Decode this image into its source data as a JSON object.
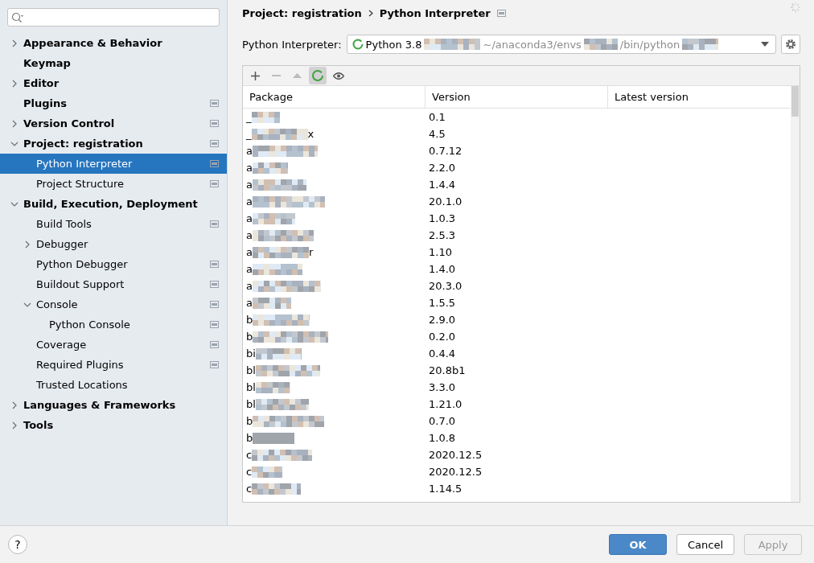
{
  "sidebar": {
    "items": [
      {
        "label": "Appearance & Behavior",
        "expanded": false,
        "selected": false,
        "project_scope": false
      },
      {
        "label": "Keymap",
        "selected": false,
        "project_scope": false
      },
      {
        "label": "Editor",
        "expanded": false,
        "selected": false,
        "project_scope": false
      },
      {
        "label": "Plugins",
        "selected": false,
        "project_scope": true
      },
      {
        "label": "Version Control",
        "expanded": false,
        "selected": false,
        "project_scope": true
      },
      {
        "label": "Project: registration",
        "expanded": true,
        "selected": false,
        "project_scope": true,
        "children": [
          {
            "label": "Python Interpreter",
            "selected": true,
            "project_scope": true
          },
          {
            "label": "Project Structure",
            "selected": false,
            "project_scope": true
          }
        ]
      },
      {
        "label": "Build, Execution, Deployment",
        "expanded": true,
        "selected": false,
        "project_scope": false,
        "children": [
          {
            "label": "Build Tools",
            "selected": false,
            "project_scope": true
          },
          {
            "label": "Debugger",
            "expanded": false,
            "selected": false,
            "project_scope": false
          },
          {
            "label": "Python Debugger",
            "selected": false,
            "project_scope": true
          },
          {
            "label": "Buildout Support",
            "selected": false,
            "project_scope": true
          },
          {
            "label": "Console",
            "expanded": true,
            "selected": false,
            "project_scope": true,
            "children": [
              {
                "label": "Python Console",
                "selected": false,
                "project_scope": true
              }
            ]
          },
          {
            "label": "Coverage",
            "selected": false,
            "project_scope": true
          },
          {
            "label": "Required Plugins",
            "selected": false,
            "project_scope": true
          },
          {
            "label": "Trusted Locations",
            "selected": false,
            "project_scope": false
          }
        ]
      },
      {
        "label": "Languages & Frameworks",
        "expanded": false,
        "selected": false,
        "project_scope": false
      },
      {
        "label": "Tools",
        "expanded": false,
        "selected": false,
        "project_scope": false
      }
    ]
  },
  "breadcrumb": [
    "Project: registration",
    "Python Interpreter"
  ],
  "breadcrumb_project_scope": true,
  "interpreter": {
    "label": "Python Interpreter:",
    "name": "Python 3.8",
    "path_parts": [
      "~/anaconda3/envs",
      "/bin/python"
    ]
  },
  "table": {
    "columns": [
      "Package",
      "Version",
      "Latest version"
    ],
    "rows": [
      {
        "package": "_",
        "version": "0.1"
      },
      {
        "package": "_",
        "package_end": "x",
        "version": "4.5"
      },
      {
        "package": "a",
        "version": "0.7.12"
      },
      {
        "package": "a",
        "version": "2.2.0"
      },
      {
        "package": "a",
        "version": "1.4.4"
      },
      {
        "package": "a",
        "version": "20.1.0"
      },
      {
        "package": "a",
        "version": "1.0.3"
      },
      {
        "package": "a",
        "version": "2.5.3"
      },
      {
        "package": "a",
        "package_end": "r",
        "version": "1.10"
      },
      {
        "package": "a",
        "version": "1.4.0"
      },
      {
        "package": "a",
        "version": "20.3.0"
      },
      {
        "package": "a",
        "version": "1.5.5"
      },
      {
        "package": "b",
        "version": "2.9.0"
      },
      {
        "package": "b",
        "version": "0.2.0"
      },
      {
        "package": "bi",
        "version": "0.4.4"
      },
      {
        "package": "bl",
        "version": "20.8b1"
      },
      {
        "package": "bl",
        "version": "3.3.0"
      },
      {
        "package": "bl",
        "version": "1.21.0"
      },
      {
        "package": "b",
        "version": "0.7.0"
      },
      {
        "package": "b",
        "version": "1.0.8"
      },
      {
        "package": "c",
        "version": "2020.12.5"
      },
      {
        "package": "c",
        "version": "2020.12.5"
      },
      {
        "package": "c",
        "version": "1.14.5"
      }
    ]
  },
  "buttons": [
    {
      "label": "OK",
      "kind": "primary",
      "disabled": false
    },
    {
      "label": "Cancel",
      "kind": "normal",
      "disabled": false
    },
    {
      "label": "Apply",
      "kind": "normal",
      "disabled": true
    }
  ],
  "help": {
    "label": "?"
  }
}
